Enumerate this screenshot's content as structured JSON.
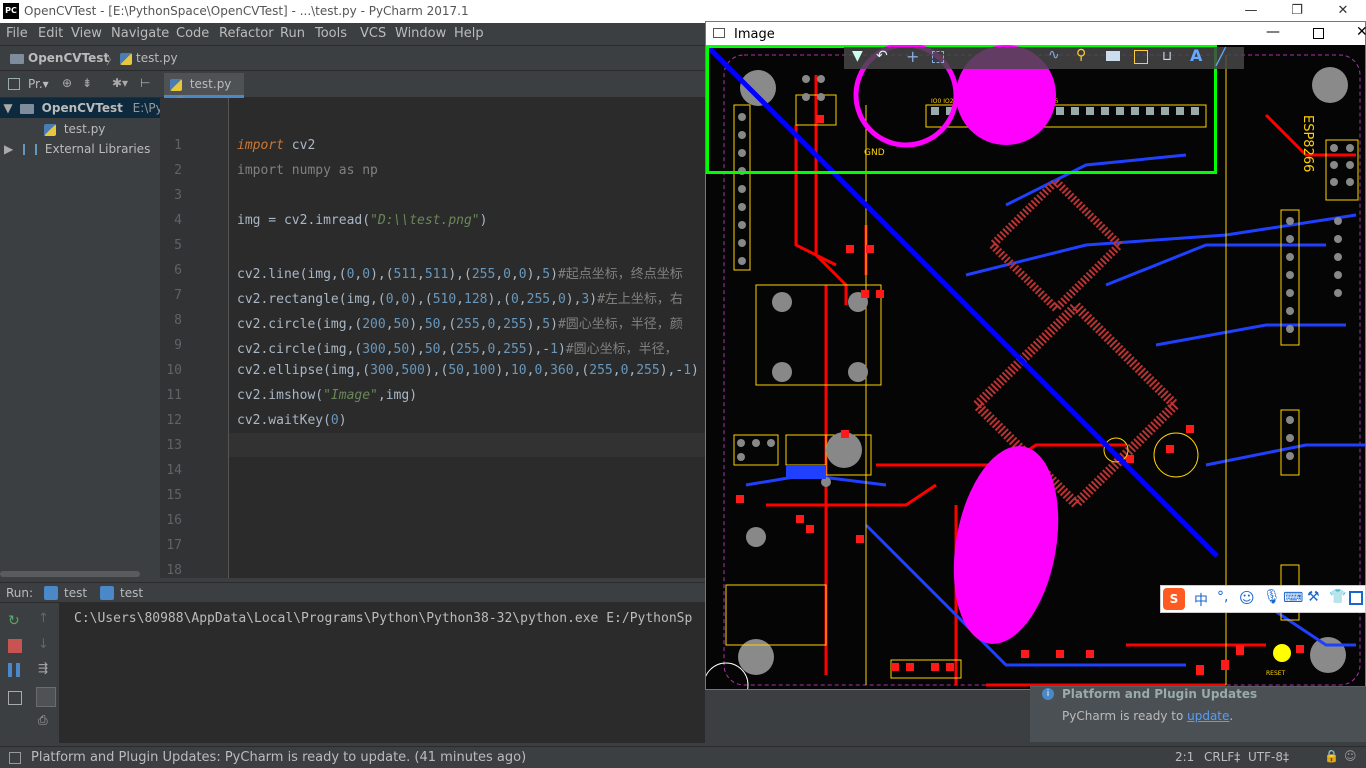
{
  "window": {
    "title": "OpenCVTest - [E:\\PythonSpace\\OpenCVTest] - ...\\test.py - PyCharm 2017.1",
    "logo_text": "PC"
  },
  "menu": [
    "File",
    "Edit",
    "View",
    "Navigate",
    "Code",
    "Refactor",
    "Run",
    "Tools",
    "VCS",
    "Window",
    "Help"
  ],
  "breadcrumb": {
    "project": "OpenCVTest",
    "file": "test.py"
  },
  "project_panel": {
    "label": "Pr.▾",
    "root_name": "OpenCVTest",
    "root_path": "E:\\Pyt",
    "file": "test.py",
    "libs": "External Libraries"
  },
  "editor": {
    "tab_label": "test.py",
    "line_numbers": [
      "1",
      "2",
      "3",
      "4",
      "5",
      "6",
      "7",
      "8",
      "9",
      "10",
      "11",
      "12",
      "13",
      "14",
      "15",
      "16",
      "17",
      "18"
    ],
    "lines": [
      [
        [
          "kw",
          "import"
        ],
        [
          "p",
          " cv2"
        ]
      ],
      [
        [
          "cmt",
          "import numpy as np"
        ]
      ],
      [],
      [
        [
          "p",
          "img = cv2.imread("
        ],
        [
          "str",
          "\"D:\\\\test.png\""
        ],
        [
          "p",
          ")"
        ]
      ],
      [],
      [
        [
          "p",
          "cv2.line(img,("
        ],
        [
          "num",
          "0"
        ],
        [
          "p",
          ","
        ],
        [
          "num",
          "0"
        ],
        [
          "p",
          "),("
        ],
        [
          "num",
          "511"
        ],
        [
          "p",
          ","
        ],
        [
          "num",
          "511"
        ],
        [
          "p",
          "),("
        ],
        [
          "num",
          "255"
        ],
        [
          "p",
          ","
        ],
        [
          "num",
          "0"
        ],
        [
          "p",
          ","
        ],
        [
          "num",
          "0"
        ],
        [
          "p",
          "),"
        ],
        [
          "num",
          "5"
        ],
        [
          "p",
          ")"
        ],
        [
          "cmt",
          "#起点坐标，终点坐标"
        ]
      ],
      [
        [
          "p",
          "cv2.rectangle(img,("
        ],
        [
          "num",
          "0"
        ],
        [
          "p",
          ","
        ],
        [
          "num",
          "0"
        ],
        [
          "p",
          "),("
        ],
        [
          "num",
          "510"
        ],
        [
          "p",
          ","
        ],
        [
          "num",
          "128"
        ],
        [
          "p",
          "),("
        ],
        [
          "num",
          "0"
        ],
        [
          "p",
          ","
        ],
        [
          "num",
          "255"
        ],
        [
          "p",
          ","
        ],
        [
          "num",
          "0"
        ],
        [
          "p",
          "),"
        ],
        [
          "num",
          "3"
        ],
        [
          "p",
          ")"
        ],
        [
          "cmt",
          "#左上坐标，右"
        ]
      ],
      [
        [
          "p",
          "cv2.circle(img,("
        ],
        [
          "num",
          "200"
        ],
        [
          "p",
          ","
        ],
        [
          "num",
          "50"
        ],
        [
          "p",
          "),"
        ],
        [
          "num",
          "50"
        ],
        [
          "p",
          ",("
        ],
        [
          "num",
          "255"
        ],
        [
          "p",
          ","
        ],
        [
          "num",
          "0"
        ],
        [
          "p",
          ","
        ],
        [
          "num",
          "255"
        ],
        [
          "p",
          "),"
        ],
        [
          "num",
          "5"
        ],
        [
          "p",
          ")"
        ],
        [
          "cmt",
          "#圆心坐标，半径，颜"
        ]
      ],
      [
        [
          "p",
          "cv2.circle(img,("
        ],
        [
          "num",
          "300"
        ],
        [
          "p",
          ","
        ],
        [
          "num",
          "50"
        ],
        [
          "p",
          "),"
        ],
        [
          "num",
          "50"
        ],
        [
          "p",
          ",("
        ],
        [
          "num",
          "255"
        ],
        [
          "p",
          ","
        ],
        [
          "num",
          "0"
        ],
        [
          "p",
          ","
        ],
        [
          "num",
          "255"
        ],
        [
          "p",
          "),-"
        ],
        [
          "num",
          "1"
        ],
        [
          "p",
          ")"
        ],
        [
          "cmt",
          "#圆心坐标，半径，"
        ]
      ],
      [
        [
          "p",
          "cv2.ellipse(img,("
        ],
        [
          "num",
          "300"
        ],
        [
          "p",
          ","
        ],
        [
          "num",
          "500"
        ],
        [
          "p",
          "),("
        ],
        [
          "num",
          "50"
        ],
        [
          "p",
          ","
        ],
        [
          "num",
          "100"
        ],
        [
          "p",
          "),"
        ],
        [
          "num",
          "10"
        ],
        [
          "p",
          ","
        ],
        [
          "num",
          "0"
        ],
        [
          "p",
          ","
        ],
        [
          "num",
          "360"
        ],
        [
          "p",
          ",("
        ],
        [
          "num",
          "255"
        ],
        [
          "p",
          ","
        ],
        [
          "num",
          "0"
        ],
        [
          "p",
          ","
        ],
        [
          "num",
          "255"
        ],
        [
          "p",
          "),-"
        ],
        [
          "num",
          "1"
        ],
        [
          "p",
          ")"
        ]
      ],
      [
        [
          "p",
          "cv2.imshow("
        ],
        [
          "str",
          "\"Image\""
        ],
        [
          "p",
          ",img)"
        ]
      ],
      [
        [
          "p",
          "cv2.waitKey("
        ],
        [
          "num",
          "0"
        ],
        [
          "p",
          ")"
        ]
      ]
    ]
  },
  "run_panel": {
    "label": "Run:",
    "tab1": "test",
    "tab2": "test",
    "console_line": "C:\\Users\\80988\\AppData\\Local\\Programs\\Python\\Python38-32\\python.exe E:/PythonSp"
  },
  "notification": {
    "title": "Platform and Plugin Updates",
    "body_prefix": "PyCharm is ready to ",
    "link": "update",
    "body_suffix": "."
  },
  "status": {
    "message": "Platform and Plugin Updates: PyCharm is ready to update. (41 minutes ago)",
    "position": "2:1",
    "line_sep": "CRLF‡",
    "encoding": "UTF-8‡"
  },
  "image_window": {
    "title": "Image",
    "board_label": "ESP8266",
    "reset_label": "RESET",
    "header_pins": "IO0 IO2 IO4 IO5 IO12 IO13 IO14 IO15 IO16",
    "gnd_label": "GND"
  },
  "ime": {
    "lang": "中"
  },
  "colors": {
    "accent": "#4a88c7",
    "magenta": "#ff00ff",
    "green": "#00ff00",
    "blue": "#0000ff",
    "pcb_red": "#ff0000"
  }
}
